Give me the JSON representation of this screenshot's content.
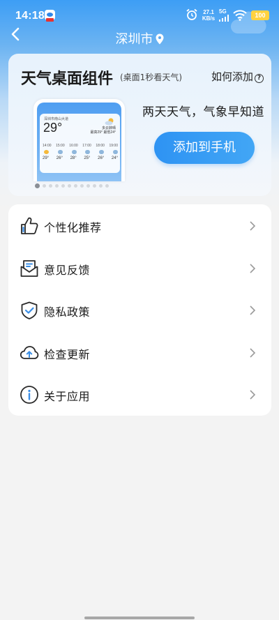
{
  "status_bar": {
    "time": "14:18",
    "net_speed": "27.1",
    "net_speed_unit": "KB/s",
    "net_type": "5G",
    "battery": "100"
  },
  "header": {
    "city": "深圳市"
  },
  "widget_card": {
    "title": "天气桌面组件",
    "subtitle": "(桌面1秒看天气)",
    "how_to_add": "如何添加",
    "slogan": "两天天气，气象早知道",
    "add_button": "添加到手机",
    "preview": {
      "location": "深圳市南山大道",
      "temperature": "29°",
      "condition": "多云转晴",
      "range": "最高29° 最低24°",
      "hours": [
        "14:00",
        "15:00",
        "16:00",
        "17:00",
        "18:00",
        "19:00"
      ],
      "temps": [
        "29°",
        "26°",
        "28°",
        "25°",
        "26°",
        "24°"
      ]
    },
    "carousel_pages": 12,
    "carousel_active_index": 0
  },
  "menu": {
    "items": [
      {
        "label": "个性化推荐",
        "icon": "thumbs-up-icon"
      },
      {
        "label": "意见反馈",
        "icon": "feedback-mail-icon"
      },
      {
        "label": "隐私政策",
        "icon": "shield-check-icon"
      },
      {
        "label": "检查更新",
        "icon": "cloud-upload-icon"
      },
      {
        "label": "关于应用",
        "icon": "info-icon"
      }
    ]
  },
  "colors": {
    "accent": "#2e93f3",
    "icon_accent": "#3a8ee6",
    "battery": "#ffd23f"
  }
}
